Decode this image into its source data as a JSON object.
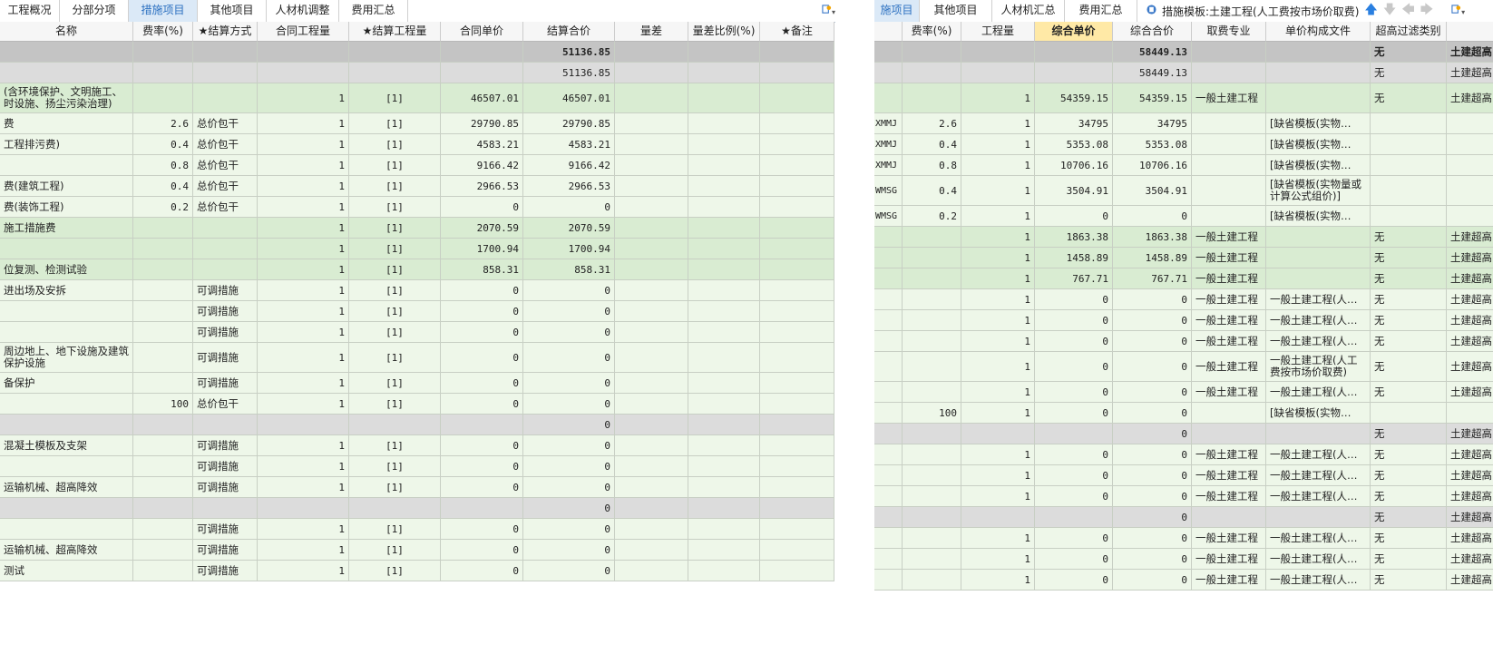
{
  "left_panel": {
    "tabs": [
      {
        "label": "工程概况",
        "w": 66,
        "active": false
      },
      {
        "label": "分部分项",
        "w": 76,
        "active": false
      },
      {
        "label": "措施项目",
        "w": 76,
        "active": true
      },
      {
        "label": "其他项目",
        "w": 76,
        "active": false
      },
      {
        "label": "人材机调整",
        "w": 80,
        "active": false
      },
      {
        "label": "费用汇总",
        "w": 76,
        "active": false
      }
    ],
    "columns": [
      {
        "label": "名称",
        "w": 147,
        "align": "txt"
      },
      {
        "label": "费率(%)",
        "w": 66,
        "align": "num"
      },
      {
        "label": "★结算方式",
        "w": 71,
        "align": "txt"
      },
      {
        "label": "合同工程量",
        "w": 101,
        "align": "num"
      },
      {
        "label": "★结算工程量",
        "w": 101,
        "align": "num"
      },
      {
        "label": "合同单价",
        "w": 91,
        "align": "num"
      },
      {
        "label": "结算合价",
        "w": 101,
        "align": "num"
      },
      {
        "label": "量差",
        "w": 81,
        "align": "num"
      },
      {
        "label": "量差比例(%)",
        "w": 79,
        "align": "num"
      },
      {
        "label": "★备注",
        "w": 82,
        "align": "txt"
      }
    ],
    "rows": [
      {
        "h": 23,
        "level": 0,
        "cells": [
          "",
          "",
          "",
          "",
          "",
          "",
          "51136.85",
          "",
          "",
          ""
        ]
      },
      {
        "h": 23,
        "level": 1,
        "cells": [
          "",
          "",
          "",
          "",
          "",
          "",
          "51136.85",
          "",
          "",
          ""
        ]
      },
      {
        "h": 33,
        "level": 2,
        "cells": [
          "(含环境保护、文明施工、时设施、扬尘污染治理)",
          "",
          "",
          "1",
          "[1]",
          "46507.01",
          "46507.01",
          "",
          "",
          ""
        ]
      },
      {
        "h": 23,
        "level": 3,
        "cells": [
          "费",
          "2.6",
          "总价包干",
          "1",
          "[1]",
          "29790.85",
          "29790.85",
          "",
          "",
          ""
        ]
      },
      {
        "h": 23,
        "level": 3,
        "cells": [
          "工程排污费)",
          "0.4",
          "总价包干",
          "1",
          "[1]",
          "4583.21",
          "4583.21",
          "",
          "",
          ""
        ]
      },
      {
        "h": 23,
        "level": 3,
        "cells": [
          "",
          "0.8",
          "总价包干",
          "1",
          "[1]",
          "9166.42",
          "9166.42",
          "",
          "",
          ""
        ]
      },
      {
        "h": 23,
        "level": 3,
        "cells": [
          "费(建筑工程)",
          "0.4",
          "总价包干",
          "1",
          "[1]",
          "2966.53",
          "2966.53",
          "",
          "",
          ""
        ]
      },
      {
        "h": 23,
        "level": 3,
        "cells": [
          "费(装饰工程)",
          "0.2",
          "总价包干",
          "1",
          "[1]",
          "0",
          "0",
          "",
          "",
          ""
        ]
      },
      {
        "h": 23,
        "level": 2,
        "cells": [
          "施工措施费",
          "",
          "",
          "1",
          "[1]",
          "2070.59",
          "2070.59",
          "",
          "",
          ""
        ]
      },
      {
        "h": 23,
        "level": 2,
        "cells": [
          "",
          "",
          "",
          "1",
          "[1]",
          "1700.94",
          "1700.94",
          "",
          "",
          ""
        ]
      },
      {
        "h": 23,
        "level": 2,
        "cells": [
          "位复测、检测试验",
          "",
          "",
          "1",
          "[1]",
          "858.31",
          "858.31",
          "",
          "",
          ""
        ]
      },
      {
        "h": 23,
        "level": 3,
        "cells": [
          "进出场及安拆",
          "",
          "可调措施",
          "1",
          "[1]",
          "0",
          "0",
          "",
          "",
          ""
        ]
      },
      {
        "h": 23,
        "level": 3,
        "cells": [
          "",
          "",
          "可调措施",
          "1",
          "[1]",
          "0",
          "0",
          "",
          "",
          ""
        ]
      },
      {
        "h": 23,
        "level": 3,
        "cells": [
          "",
          "",
          "可调措施",
          "1",
          "[1]",
          "0",
          "0",
          "",
          "",
          ""
        ]
      },
      {
        "h": 33,
        "level": 3,
        "cells": [
          "周边地上、地下设施及建筑保护设施",
          "",
          "可调措施",
          "1",
          "[1]",
          "0",
          "0",
          "",
          "",
          ""
        ]
      },
      {
        "h": 23,
        "level": 3,
        "cells": [
          "备保护",
          "",
          "可调措施",
          "1",
          "[1]",
          "0",
          "0",
          "",
          "",
          ""
        ]
      },
      {
        "h": 23,
        "level": 3,
        "cells": [
          "",
          "100",
          "总价包干",
          "1",
          "[1]",
          "0",
          "0",
          "",
          "",
          ""
        ]
      },
      {
        "h": 23,
        "level": 1,
        "cells": [
          "",
          "",
          "",
          "",
          "",
          "",
          "0",
          "",
          "",
          ""
        ]
      },
      {
        "h": 23,
        "level": 3,
        "cells": [
          "混凝土模板及支架",
          "",
          "可调措施",
          "1",
          "[1]",
          "0",
          "0",
          "",
          "",
          ""
        ]
      },
      {
        "h": 23,
        "level": 3,
        "cells": [
          "",
          "",
          "可调措施",
          "1",
          "[1]",
          "0",
          "0",
          "",
          "",
          ""
        ]
      },
      {
        "h": 23,
        "level": 3,
        "cells": [
          "运输机械、超高降效",
          "",
          "可调措施",
          "1",
          "[1]",
          "0",
          "0",
          "",
          "",
          ""
        ]
      },
      {
        "h": 23,
        "level": 1,
        "cells": [
          "",
          "",
          "",
          "",
          "",
          "",
          "0",
          "",
          "",
          ""
        ]
      },
      {
        "h": 23,
        "level": 3,
        "cells": [
          "",
          "",
          "可调措施",
          "1",
          "[1]",
          "0",
          "0",
          "",
          "",
          ""
        ]
      },
      {
        "h": 23,
        "level": 3,
        "cells": [
          "运输机械、超高降效",
          "",
          "可调措施",
          "1",
          "[1]",
          "0",
          "0",
          "",
          "",
          ""
        ]
      },
      {
        "h": 23,
        "level": 3,
        "cells": [
          "测试",
          "",
          "可调措施",
          "1",
          "[1]",
          "0",
          "0",
          "",
          "",
          ""
        ]
      }
    ]
  },
  "right_panel": {
    "tabs": [
      {
        "label": "施项目",
        "w": 50,
        "active": true
      },
      {
        "label": "其他项目",
        "w": 80,
        "active": false
      },
      {
        "label": "人材机汇总",
        "w": 80,
        "active": false
      },
      {
        "label": "费用汇总",
        "w": 80,
        "active": false
      }
    ],
    "template_label": "措施模板:土建工程(人工费按市场价取费)",
    "columns": [
      {
        "label": "",
        "w": 31,
        "align": "txt"
      },
      {
        "label": "费率(%)",
        "w": 65,
        "align": "num"
      },
      {
        "label": "工程量",
        "w": 81,
        "align": "num"
      },
      {
        "label": "综合单价",
        "w": 86,
        "align": "num",
        "highlight": true
      },
      {
        "label": "综合合价",
        "w": 87,
        "align": "num"
      },
      {
        "label": "取费专业",
        "w": 82,
        "align": "txt"
      },
      {
        "label": "单价构成文件",
        "w": 115,
        "align": "txt"
      },
      {
        "label": "超高过滤类别",
        "w": 84,
        "align": "txt"
      },
      {
        "label": "",
        "w": 60,
        "align": "txt"
      }
    ],
    "rows": [
      {
        "h": 23,
        "level": 0,
        "cells": [
          "",
          "",
          "",
          "",
          "58449.13",
          "",
          "",
          "无",
          "土建超高"
        ]
      },
      {
        "h": 23,
        "level": 1,
        "cells": [
          "",
          "",
          "",
          "",
          "58449.13",
          "",
          "",
          "无",
          "土建超高"
        ]
      },
      {
        "h": 33,
        "level": 2,
        "cells": [
          "",
          "",
          "1",
          "54359.15",
          "54359.15",
          "一般土建工程",
          "",
          "无",
          "土建超高"
        ]
      },
      {
        "h": 23,
        "level": 3,
        "cells": [
          "XMMJ",
          "2.6",
          "1",
          "34795",
          "34795",
          "",
          "[缺省模板(实物…",
          "",
          ""
        ]
      },
      {
        "h": 23,
        "level": 3,
        "cells": [
          "XMMJ",
          "0.4",
          "1",
          "5353.08",
          "5353.08",
          "",
          "[缺省模板(实物…",
          "",
          ""
        ]
      },
      {
        "h": 23,
        "level": 3,
        "cells": [
          "XMMJ",
          "0.8",
          "1",
          "10706.16",
          "10706.16",
          "",
          "[缺省模板(实物…",
          "",
          ""
        ]
      },
      {
        "h": 33,
        "level": 3,
        "cells": [
          "WMSG",
          "0.4",
          "1",
          "3504.91",
          "3504.91",
          "",
          "[缺省模板(实物量或计算公式组价)]",
          "",
          ""
        ]
      },
      {
        "h": 23,
        "level": 3,
        "cells": [
          "WMSG",
          "0.2",
          "1",
          "0",
          "0",
          "",
          "[缺省模板(实物…",
          "",
          ""
        ]
      },
      {
        "h": 23,
        "level": 2,
        "cells": [
          "",
          "",
          "1",
          "1863.38",
          "1863.38",
          "一般土建工程",
          "",
          "无",
          "土建超高"
        ]
      },
      {
        "h": 23,
        "level": 2,
        "cells": [
          "",
          "",
          "1",
          "1458.89",
          "1458.89",
          "一般土建工程",
          "",
          "无",
          "土建超高"
        ]
      },
      {
        "h": 23,
        "level": 2,
        "cells": [
          "",
          "",
          "1",
          "767.71",
          "767.71",
          "一般土建工程",
          "",
          "无",
          "土建超高"
        ]
      },
      {
        "h": 23,
        "level": 3,
        "cells": [
          "",
          "",
          "1",
          "0",
          "0",
          "一般土建工程",
          "一般土建工程(人…",
          "无",
          "土建超高"
        ]
      },
      {
        "h": 23,
        "level": 3,
        "cells": [
          "",
          "",
          "1",
          "0",
          "0",
          "一般土建工程",
          "一般土建工程(人…",
          "无",
          "土建超高"
        ]
      },
      {
        "h": 23,
        "level": 3,
        "cells": [
          "",
          "",
          "1",
          "0",
          "0",
          "一般土建工程",
          "一般土建工程(人…",
          "无",
          "土建超高"
        ]
      },
      {
        "h": 33,
        "level": 3,
        "cells": [
          "",
          "",
          "1",
          "0",
          "0",
          "一般土建工程",
          "一般土建工程(人工费按市场价取费)",
          "无",
          "土建超高"
        ]
      },
      {
        "h": 23,
        "level": 3,
        "cells": [
          "",
          "",
          "1",
          "0",
          "0",
          "一般土建工程",
          "一般土建工程(人…",
          "无",
          "土建超高"
        ]
      },
      {
        "h": 23,
        "level": 3,
        "cells": [
          "",
          "100",
          "1",
          "0",
          "0",
          "",
          "[缺省模板(实物…",
          "",
          ""
        ]
      },
      {
        "h": 23,
        "level": 1,
        "cells": [
          "",
          "",
          "",
          "",
          "0",
          "",
          "",
          "无",
          "土建超高"
        ]
      },
      {
        "h": 23,
        "level": 3,
        "cells": [
          "",
          "",
          "1",
          "0",
          "0",
          "一般土建工程",
          "一般土建工程(人…",
          "无",
          "土建超高"
        ]
      },
      {
        "h": 23,
        "level": 3,
        "cells": [
          "",
          "",
          "1",
          "0",
          "0",
          "一般土建工程",
          "一般土建工程(人…",
          "无",
          "土建超高"
        ]
      },
      {
        "h": 23,
        "level": 3,
        "cells": [
          "",
          "",
          "1",
          "0",
          "0",
          "一般土建工程",
          "一般土建工程(人…",
          "无",
          "土建超高"
        ]
      },
      {
        "h": 23,
        "level": 1,
        "cells": [
          "",
          "",
          "",
          "",
          "0",
          "",
          "",
          "无",
          "土建超高"
        ]
      },
      {
        "h": 23,
        "level": 3,
        "cells": [
          "",
          "",
          "1",
          "0",
          "0",
          "一般土建工程",
          "一般土建工程(人…",
          "无",
          "土建超高"
        ]
      },
      {
        "h": 23,
        "level": 3,
        "cells": [
          "",
          "",
          "1",
          "0",
          "0",
          "一般土建工程",
          "一般土建工程(人…",
          "无",
          "土建超高"
        ]
      },
      {
        "h": 23,
        "level": 3,
        "cells": [
          "",
          "",
          "1",
          "0",
          "0",
          "一般土建工程",
          "一般土建工程(人…",
          "无",
          "土建超高"
        ]
      }
    ]
  },
  "level_colors": [
    "#c4c4c4",
    "#dcdcdc",
    "#d9ecd2",
    "#eef7e9"
  ],
  "icons": {
    "toolbar": "settings-dropdown-icon",
    "template": "template-icon",
    "up": "arrow-up-icon",
    "down": "arrow-down-icon",
    "left": "arrow-left-icon",
    "right": "arrow-right-icon"
  }
}
